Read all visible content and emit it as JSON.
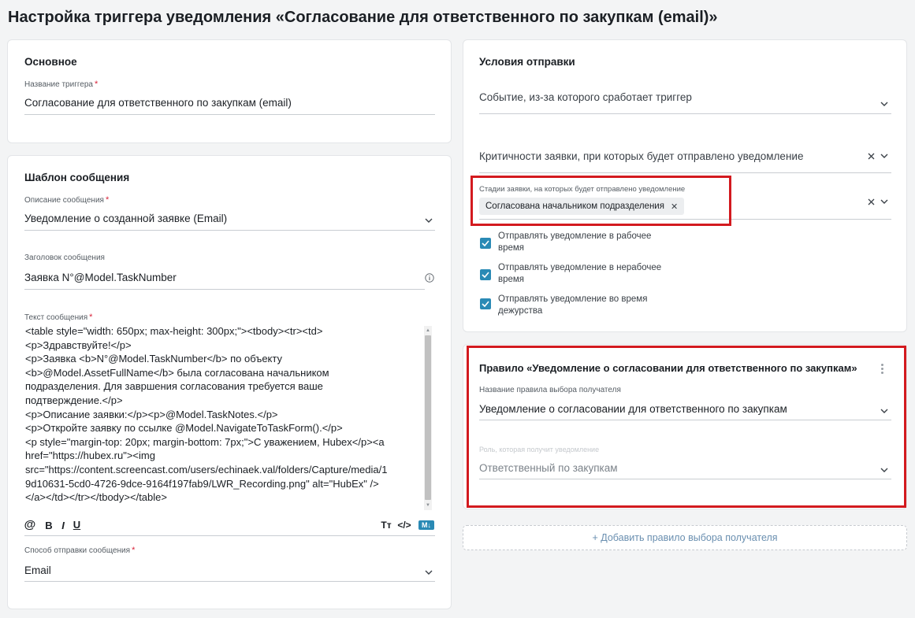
{
  "page": {
    "title": "Настройка триггера уведомления «Согласование для ответственного по закупкам (email)»"
  },
  "basic": {
    "title": "Основное",
    "trigger_name_label": "Название триггера",
    "trigger_name_value": "Согласование  для ответственного по закупкам (email)"
  },
  "template": {
    "title": "Шаблон сообщения",
    "description_label": "Описание сообщения",
    "description_value": "Уведомление о созданной заявке (Email)",
    "subject_label": "Заголовок сообщения",
    "subject_value": "Заявка N°@Model.TaskNumber",
    "body_label": "Текст сообщения",
    "body_value": "<table style=\"width: 650px; max-height: 300px;\"><tbody><tr><td>\n<p>Здравствуйте!</p>\n<p>Заявка <b>N°@Model.TaskNumber</b> по объекту\n<b>@Model.AssetFullName</b> была согласована начальником\nподразделения. Для завршения согласования требуется ваше\nподтверждение.</p>\n<p>Описание заявки:</p><p>@Model.TaskNotes.</p>\n<p>Откройте заявку по ссылке @Model.NavigateToTaskForm().</p>\n<p style=\"margin-top: 20px; margin-bottom: 7px;\">С уважением, Hubex</p><a\nhref=\"https://hubex.ru\"><img\nsrc=\"https://content.screencast.com/users/echinaek.val/folders/Capture/media/1\n9d10631-5cd0-4726-9dce-9164f197fab9/LWR_Recording.png\" alt=\"HubEx\" />\n</a></td></tr></tbody></table>",
    "toolbar": {
      "mention": "@",
      "bold": "B",
      "italic": "I",
      "underline": "U",
      "text_size": "Tт",
      "code": "</>",
      "markdown": "M↓"
    },
    "send_method_label": "Способ отправки сообщения",
    "send_method_value": "Email"
  },
  "conditions": {
    "title": "Условия отправки",
    "event_label": "Событие, из-за которого сработает триггер",
    "criticality_label": "Критичности заявки, при которых будет отправлено уведомление",
    "stages_label": "Стадии заявки, на которых будет отправлено уведомление",
    "stages_chip": "Согласована начальником подразделения",
    "checkboxes": [
      {
        "label": "Отправлять уведомление в рабочее время",
        "checked": true
      },
      {
        "label": "Отправлять уведомление в нерабочее время",
        "checked": true
      },
      {
        "label": "Отправлять уведомление во время дежурства",
        "checked": true
      }
    ]
  },
  "rule": {
    "title": "Правило «Уведомление о согласовании для ответственного по закупкам»",
    "rule_name_label": "Название правила выбора получателя",
    "rule_name_value": "Уведомление о согласовании для ответственного по закупкам",
    "role_label": "Роль, которая получит уведомление",
    "role_value": "Ответственный по закупкам"
  },
  "add_rule_label": "+ Добавить правило выбора получателя",
  "colors": {
    "accent": "#2a8ab5",
    "highlight": "#d31a1f",
    "required": "#d8243b",
    "link": "#6a8fb0"
  },
  "icons": [
    "chevron-down-icon",
    "close-icon",
    "info-icon",
    "check-icon",
    "kebab-icon"
  ]
}
